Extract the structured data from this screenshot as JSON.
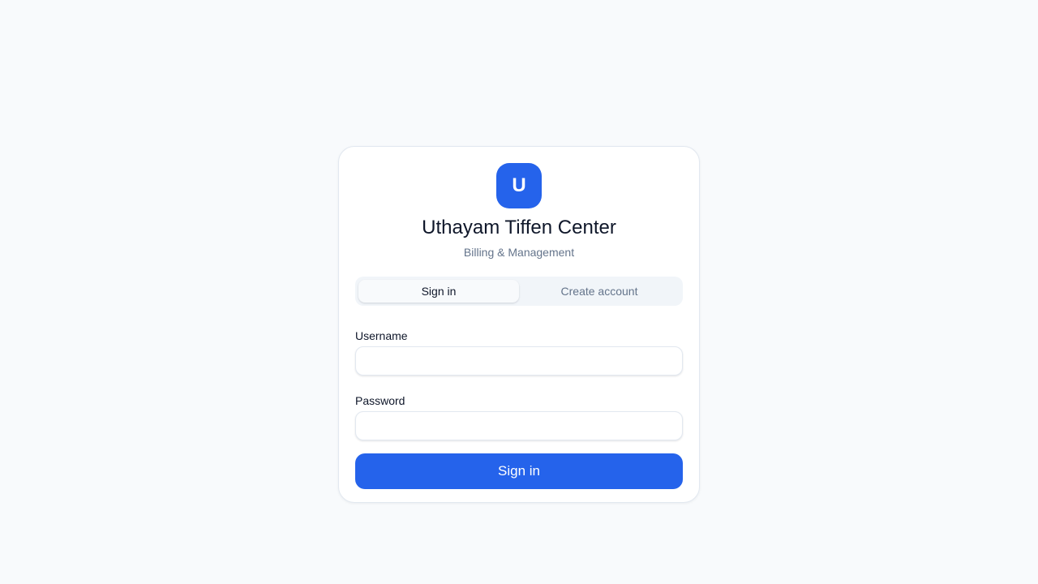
{
  "brand": {
    "logo_letter": "U",
    "title": "Uthayam Tiffen Center",
    "subtitle": "Billing & Management",
    "accent_color": "#2563eb"
  },
  "tabs": [
    {
      "label": "Sign in",
      "active": true
    },
    {
      "label": "Create account",
      "active": false
    }
  ],
  "form": {
    "username_label": "Username",
    "username_value": "",
    "password_label": "Password",
    "password_value": "",
    "submit_label": "Sign in"
  }
}
